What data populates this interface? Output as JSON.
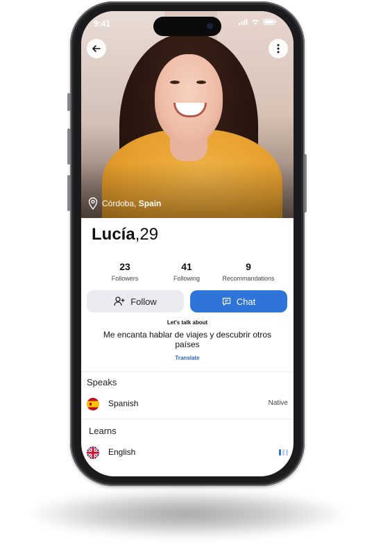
{
  "status_bar": {
    "time": "9:41"
  },
  "profile": {
    "name": "Lucía",
    "age": ",29",
    "location_city": "Córdoba, ",
    "location_country": "Spain"
  },
  "stats": [
    {
      "value": "23",
      "label": "Followers"
    },
    {
      "value": "41",
      "label": "Following"
    },
    {
      "value": "9",
      "label": "Recommandations"
    }
  ],
  "actions": {
    "follow_label": "Follow",
    "chat_label": "Chat"
  },
  "about": {
    "heading": "Let's talk about",
    "text": "Me encanta hablar de viajes y descubrir otros países",
    "translate_label": "Translate"
  },
  "speaks": {
    "title": "Speaks",
    "items": [
      {
        "language": "Spanish",
        "level": "Native",
        "flag": "spain-flag"
      }
    ]
  },
  "learns": {
    "title": "Learns",
    "items": [
      {
        "language": "English",
        "flag": "uk-flag",
        "level_fraction": 0.33
      }
    ]
  },
  "colors": {
    "accent": "#2f74d9",
    "translate": "#2f63b8",
    "follow_bg": "#e9ebf0"
  },
  "icons": [
    "back-arrow-icon",
    "more-vertical-icon",
    "location-pin-icon",
    "add-user-icon",
    "chat-icon",
    "signal-icon",
    "wifi-icon",
    "battery-icon"
  ]
}
